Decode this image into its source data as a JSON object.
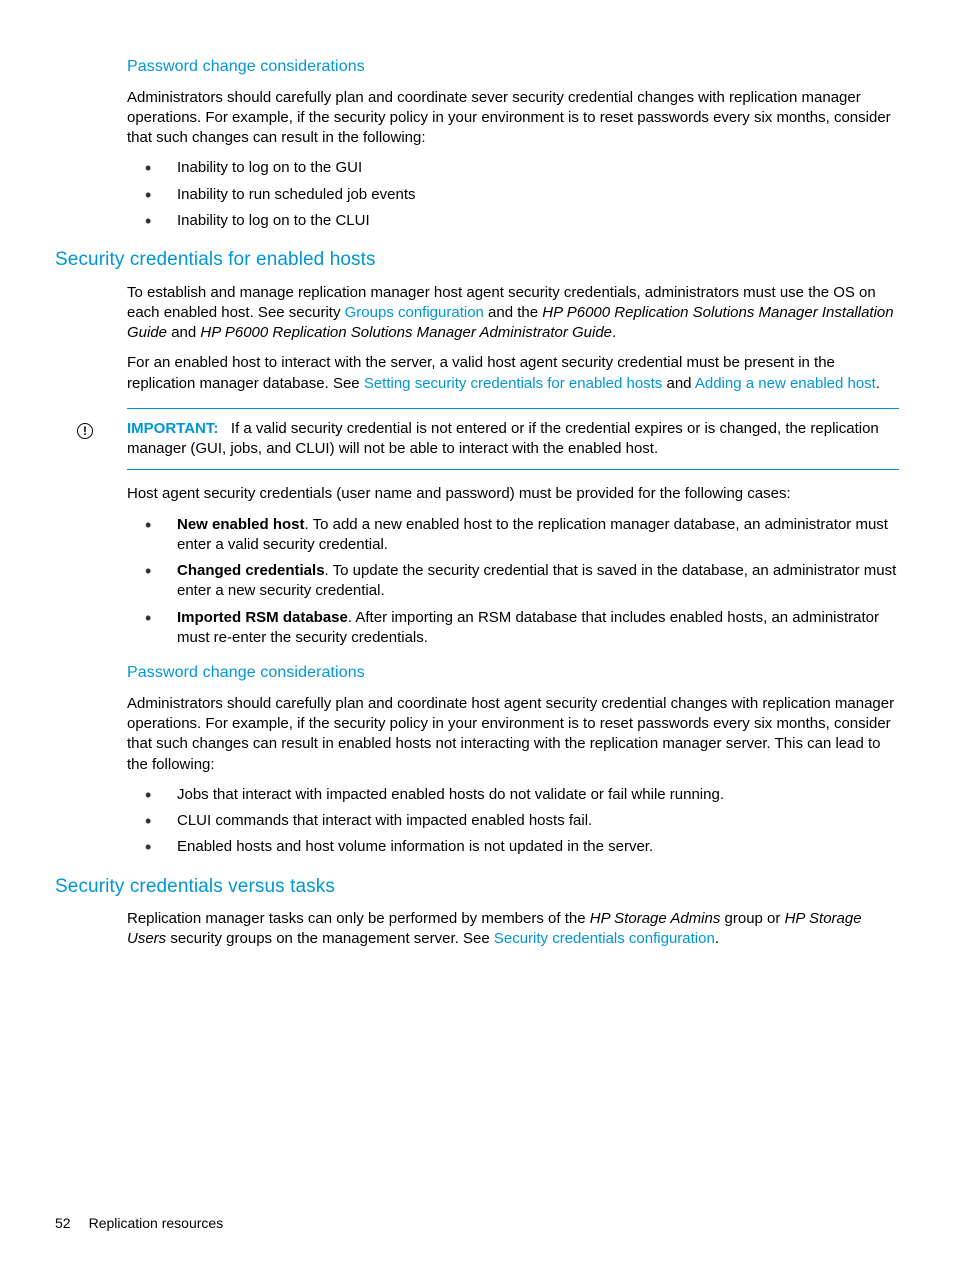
{
  "section1": {
    "heading": "Password change considerations",
    "para": "Administrators should carefully plan and coordinate sever security credential changes with replication manager operations. For example, if the security policy in your environment is to reset passwords every six months, consider that such changes can result in the following:",
    "bullets": [
      "Inability to log on to the GUI",
      "Inability to run scheduled job events",
      "Inability to log on to the CLUI"
    ]
  },
  "section2": {
    "heading": "Security credentials for enabled hosts",
    "para1_a": "To establish and manage replication manager host agent security credentials, administrators must use the OS on each enabled host. See security ",
    "para1_link1": "Groups configuration",
    "para1_b": " and the ",
    "para1_italic1": "HP P6000 Replication Solutions Manager Installation Guide",
    "para1_c": " and ",
    "para1_italic2": "HP P6000 Replication Solutions Manager Administrator Guide",
    "para1_d": ".",
    "para2_a": "For an enabled host to interact with the server, a valid host agent security credential must be present in the replication manager database. See ",
    "para2_link1": "Setting security credentials for enabled hosts",
    "para2_b": " and ",
    "para2_link2": "Adding a new enabled host",
    "para2_c": ".",
    "important_label": "IMPORTANT:",
    "important_text": "If a valid security credential is not entered or if the credential expires or is changed, the replication manager (GUI, jobs, and CLUI) will not be able to interact with the enabled host.",
    "para3": "Host agent security credentials (user name and password) must be provided for the following cases:",
    "bullets2": [
      {
        "bold": "New enabled host",
        "rest": ". To add a new enabled host to the replication manager database, an administrator must enter a valid security credential."
      },
      {
        "bold": "Changed credentials",
        "rest": ". To update the security credential that is saved in the database, an administrator must enter a new security credential."
      },
      {
        "bold": "Imported RSM database",
        "rest": ". After importing an RSM database that includes enabled hosts, an administrator must re-enter the security credentials."
      }
    ],
    "subheading2": "Password change considerations",
    "para4": "Administrators should carefully plan and coordinate host agent security credential changes with replication manager operations. For example, if the security policy in your environment is to reset passwords every six months, consider that such changes can result in enabled hosts not interacting with the replication manager server. This can lead to the following:",
    "bullets3": [
      "Jobs that interact with impacted enabled hosts do not validate or fail while running.",
      "CLUI commands that interact with impacted enabled hosts fail.",
      "Enabled hosts and host volume information is not updated in the server."
    ]
  },
  "section3": {
    "heading": "Security credentials versus tasks",
    "para_a": "Replication manager tasks can only be performed by members of the ",
    "para_italic1": "HP Storage Admins",
    "para_b": " group or ",
    "para_italic2": "HP Storage Users",
    "para_c": " security groups on the management server. See ",
    "para_link": "Security credentials configuration",
    "para_d": "."
  },
  "footer": {
    "page": "52",
    "title": "Replication resources"
  }
}
